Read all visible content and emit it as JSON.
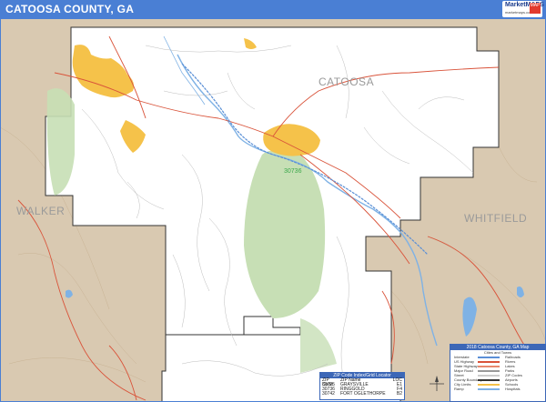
{
  "header": {
    "title": "CATOOSA COUNTY, GA",
    "logo_word": "MarketMAPS",
    "logo_badge": "MAP",
    "logo_sub": "marketmaps.com"
  },
  "map": {
    "counties": {
      "center": "CATOOSA",
      "west": "WALKER",
      "east": "WHITFIELD"
    },
    "zip_label": "30736",
    "colors": {
      "county_fill": "#ffffff",
      "outside_fill": "#d9c9b1",
      "city_fill": "#f5c24a",
      "park_fill": "#c7dfb5",
      "water": "#7fb2e5",
      "highway": "#d9533a",
      "road": "#bdbdbd",
      "boundary": "#333333"
    }
  },
  "zip_table": {
    "title": "ZIP Code Index/Grid Locator",
    "headers": [
      "ZIP Code",
      "ZIP Name",
      "LOC"
    ],
    "rows": [
      [
        "30725",
        "GRAYSVILLE",
        "E1"
      ],
      [
        "30736",
        "RINGGOLD",
        "F4"
      ],
      [
        "30742",
        "FORT OGLETHORPE",
        "B2"
      ]
    ]
  },
  "legend": {
    "title": "2018 Catoosa County, GA Map",
    "subtitle": "Cities and Towns",
    "rows": [
      {
        "label": "Interstate",
        "right": "Railroads"
      },
      {
        "label": "US Highway",
        "right": "Rivers"
      },
      {
        "label": "State Highway",
        "right": "Lakes"
      },
      {
        "label": "Major Road",
        "right": "Parks"
      },
      {
        "label": "Street",
        "right": "ZIP Codes"
      },
      {
        "label": "County Boundary",
        "right": "Airports"
      },
      {
        "label": "City Limits",
        "right": "Schools"
      },
      {
        "label": "Ramp",
        "right": "Hospitals"
      }
    ]
  }
}
